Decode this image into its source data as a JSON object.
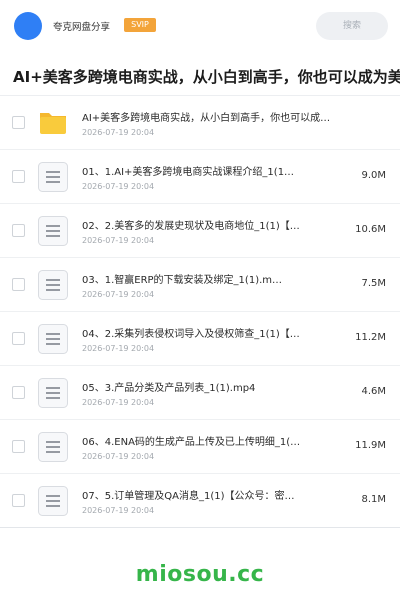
{
  "header": {
    "username": "夸克网盘分享",
    "badge": "SVIP",
    "search_placeholder": "搜索",
    "accent_color": "#2f7ff5",
    "badge_color": "#f3a43a"
  },
  "page_title": "AI+美客多跨境电商实战，从小白到高手，你也可以成为美客多",
  "files": [
    {
      "name": "AI+美客多跨境电商实战，从小白到高手，你也可以成…",
      "date": "2026-07-19 20:04",
      "size": "",
      "icon": "folder-icon"
    },
    {
      "name": "01、1.AI+美客多跨境电商实战课程介绍_1(1…",
      "date": "2026-07-19 20:04",
      "size": "9.0M",
      "icon": "document-icon"
    },
    {
      "name": "02、2.美客多的发展史现状及电商地位_1(1)【…",
      "date": "2026-07-19 20:04",
      "size": "10.6M",
      "icon": "document-icon"
    },
    {
      "name": "03、1.智赢ERP的下载安装及绑定_1(1).m…",
      "date": "2026-07-19 20:04",
      "size": "7.5M",
      "icon": "document-icon"
    },
    {
      "name": "04、2.采集列表侵权词导入及侵权筛查_1(1)【…",
      "date": "2026-07-19 20:04",
      "size": "11.2M",
      "icon": "document-icon"
    },
    {
      "name": "05、3.产品分类及产品列表_1(1).mp4",
      "date": "2026-07-19 20:04",
      "size": "4.6M",
      "icon": "document-icon"
    },
    {
      "name": "06、4.ENA码的生成产品上传及已上传明细_1(…",
      "date": "2026-07-19 20:04",
      "size": "11.9M",
      "icon": "document-icon"
    },
    {
      "name": "07、5.订单管理及QA消息_1(1)【公众号：密…",
      "date": "2026-07-19 20:04",
      "size": "8.1M",
      "icon": "document-icon"
    }
  ],
  "watermark": "miosou.cc",
  "watermark_color": "#36b54a"
}
